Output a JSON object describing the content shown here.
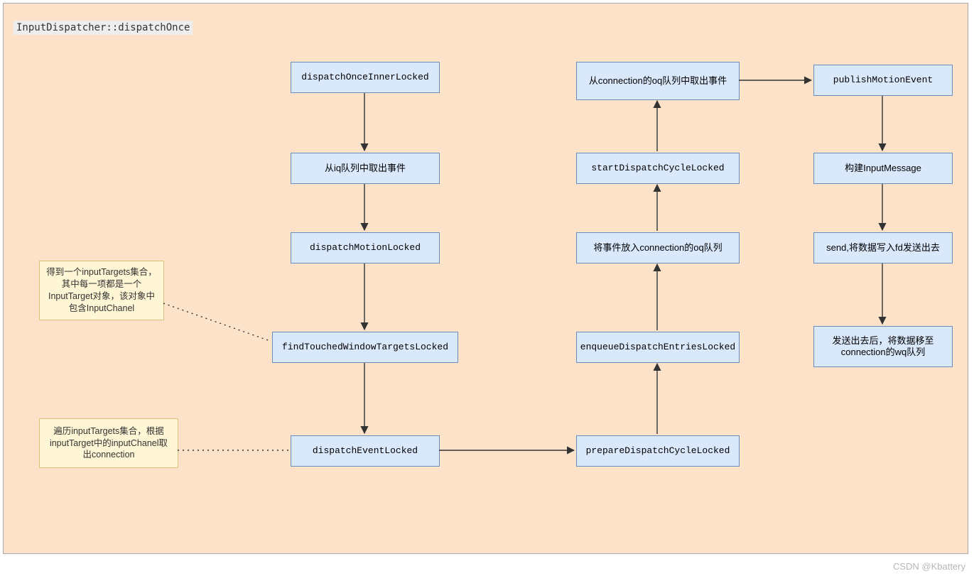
{
  "title": "InputDispatcher::dispatchOnce",
  "nodes": {
    "n1": "dispatchOnceInnerLocked",
    "n2": "从iq队列中取出事件",
    "n3": "dispatchMotionLocked",
    "n4": "findTouchedWindowTargetsLocked",
    "n5": "dispatchEventLocked",
    "n6": "prepareDispatchCycleLocked",
    "n7": "enqueueDispatchEntriesLocked",
    "n8": "将事件放入connection的oq队列",
    "n9": "startDispatchCycleLocked",
    "n10": "从connection的oq队列中取出事件",
    "n11": "publishMotionEvent",
    "n12": "构建InputMessage",
    "n13": "send,将数据写入fd发送出去",
    "n14": "发送出去后，将数据移至connection的wq队列"
  },
  "notes": {
    "noteA": "得到一个inputTargets集合，其中每一项都是一个InputTarget对象，该对象中包含InputChanel",
    "noteB": "遍历inputTargets集合，根据inputTarget中的inputChanel取出connection"
  },
  "watermark": "CSDN @Kbattery"
}
